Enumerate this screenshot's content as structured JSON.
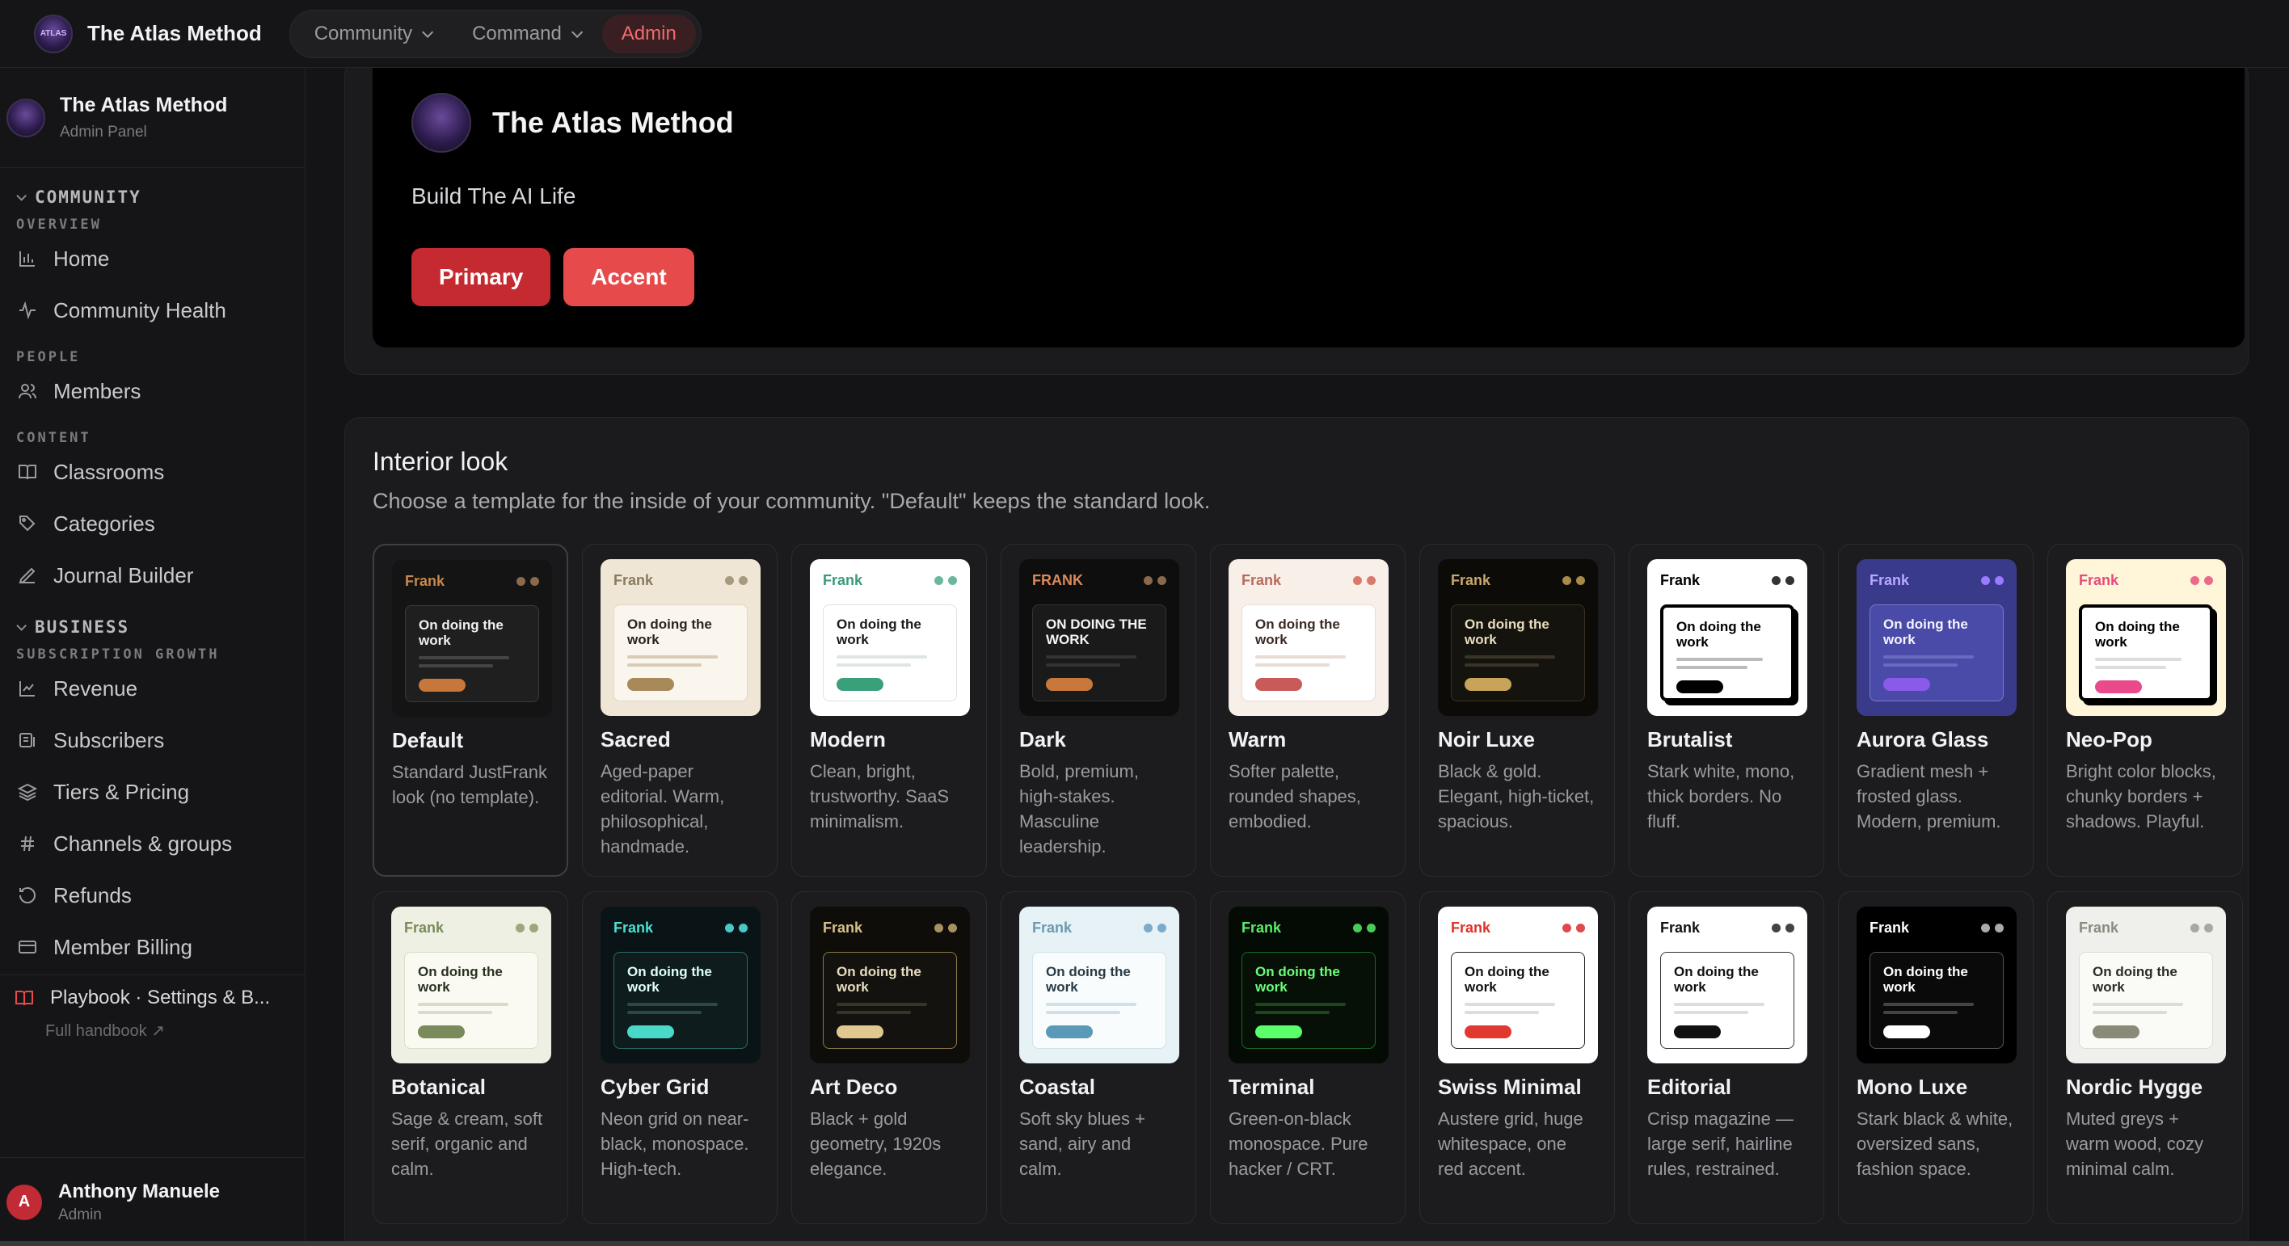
{
  "topbar": {
    "brand": "The Atlas Method",
    "logo_text": "ATLAS",
    "nav": [
      {
        "label": "Community",
        "chevron": true,
        "active": false
      },
      {
        "label": "Command",
        "chevron": true,
        "active": false
      },
      {
        "label": "Admin",
        "chevron": false,
        "active": true
      }
    ]
  },
  "sidebar": {
    "title": "The Atlas Method",
    "subtitle": "Admin Panel",
    "community_label": "COMMUNITY",
    "overview_label": "OVERVIEW",
    "home": "Home",
    "community_health": "Community Health",
    "people_label": "PEOPLE",
    "members": "Members",
    "content_label": "CONTENT",
    "classrooms": "Classrooms",
    "categories": "Categories",
    "journal_builder": "Journal Builder",
    "business_label": "BUSINESS",
    "subscription_label": "SUBSCRIPTION GROWTH",
    "revenue": "Revenue",
    "subscribers": "Subscribers",
    "tiers": "Tiers & Pricing",
    "channels": "Channels & groups",
    "refunds": "Refunds",
    "member_billing": "Member Billing",
    "playbook": "Playbook · Settings & B...",
    "full_handbook": "Full handbook ↗",
    "user_name": "Anthony Manuele",
    "user_role": "Admin",
    "user_initial": "A"
  },
  "preview": {
    "title": "The Atlas Method",
    "subtitle": "Build The AI Life",
    "primary": "Primary",
    "accent": "Accent"
  },
  "interior": {
    "title": "Interior look",
    "description": "Choose a template for the inside of your community. \"Default\" keeps the standard look.",
    "templates": [
      {
        "name": "Default",
        "desc": "Standard JustFrank look (no template).",
        "brand": "Frank",
        "heading": "On doing the work",
        "colors": {
          "bg": "#141414",
          "box": "#1f1f1f",
          "border": "#3a3a3a",
          "brand": "#c8894a",
          "text": "#f0f0f0",
          "line": "#444",
          "pill": "#c8773a",
          "dot": "#8a6a4a"
        }
      },
      {
        "name": "Sacred",
        "desc": "Aged-paper editorial. Warm, philosophical, handmade.",
        "brand": "Frank",
        "heading": "On doing the work",
        "colors": {
          "bg": "#efe6d6",
          "box": "#faf6ee",
          "border": "#e2d8c6",
          "brand": "#8a7a60",
          "text": "#2a2420",
          "line": "#d8ccb8",
          "pill": "#a88a5a",
          "dot": "#a89a80"
        }
      },
      {
        "name": "Modern",
        "desc": "Clean, bright, trustworthy. SaaS minimalism.",
        "brand": "Frank",
        "heading": "On doing the work",
        "colors": {
          "bg": "#ffffff",
          "box": "#ffffff",
          "border": "#dde3e0",
          "brand": "#3a9a7a",
          "text": "#1a1a1a",
          "line": "#dfe6e2",
          "pill": "#3aa07a",
          "dot": "#6ab89a"
        }
      },
      {
        "name": "Dark",
        "desc": "Bold, premium, high-stakes. Masculine leadership.",
        "brand": "FRANK",
        "heading": "ON DOING THE WORK",
        "colors": {
          "bg": "#0e0e0e",
          "box": "#1a1a1a",
          "border": "#333",
          "brand": "#d88a5a",
          "text": "#f4f4f4",
          "line": "#333",
          "pill": "#c8783a",
          "dot": "#8a6a4a"
        }
      },
      {
        "name": "Warm",
        "desc": "Softer palette, rounded shapes, embodied.",
        "brand": "Frank",
        "heading": "On doing the work",
        "colors": {
          "bg": "#f7efe8",
          "box": "#ffffff",
          "border": "#ecdcd2",
          "brand": "#b86a5a",
          "text": "#3a2a24",
          "line": "#e8dcd4",
          "pill": "#c85a5a",
          "dot": "#d87a6a"
        }
      },
      {
        "name": "Noir Luxe",
        "desc": "Black & gold. Elegant, high-ticket, spacious.",
        "brand": "Frank",
        "heading": "On doing the work",
        "colors": {
          "bg": "#0c0b08",
          "box": "#15130e",
          "border": "#3a3220",
          "brand": "#c8a86a",
          "text": "#e8dcc0",
          "line": "#3a3428",
          "pill": "#c8a45a",
          "dot": "#a88a4a"
        }
      },
      {
        "name": "Brutalist",
        "desc": "Stark white, mono, thick borders. No fluff.",
        "brand": "Frank",
        "heading": "On doing the work",
        "colors": {
          "bg": "#ffffff",
          "box": "#ffffff",
          "border": "#000000",
          "brand": "#000000",
          "text": "#000000",
          "line": "#bbbbbb",
          "pill": "#000000",
          "dot": "#333333"
        }
      },
      {
        "name": "Aurora Glass",
        "desc": "Gradient mesh + frosted glass. Modern, premium.",
        "brand": "Frank",
        "heading": "On doing the work",
        "colors": {
          "bg": "#3a3a8a",
          "box": "#4a4aa8",
          "border": "#7a7ac8",
          "brand": "#b8a8ff",
          "text": "#f4f4ff",
          "line": "#6a6ac0",
          "pill": "#8a5aea",
          "dot": "#9a7aff"
        }
      },
      {
        "name": "Neo-Pop",
        "desc": "Bright color blocks, chunky borders + shadows. Playful.",
        "brand": "Frank",
        "heading": "On doing the work",
        "colors": {
          "bg": "#fff6da",
          "box": "#ffffff",
          "border": "#000000",
          "brand": "#e84a7a",
          "text": "#000000",
          "line": "#dddddd",
          "pill": "#ea4a8a",
          "dot": "#ea6a8a"
        }
      },
      {
        "name": "Botanical",
        "desc": "Sage & cream, soft serif, organic and calm.",
        "brand": "Frank",
        "heading": "On doing the work",
        "colors": {
          "bg": "#eef0e4",
          "box": "#fafaf2",
          "border": "#d8dcc8",
          "brand": "#7a8a5a",
          "text": "#2a3020",
          "line": "#d8dcc8",
          "pill": "#7a8a5a",
          "dot": "#9aa87a"
        }
      },
      {
        "name": "Cyber Grid",
        "desc": "Neon grid on near-black, monospace. High-tech.",
        "brand": "Frank",
        "heading": "On doing the work",
        "colors": {
          "bg": "#0a1416",
          "box": "#0e1c1e",
          "border": "#2a6a6a",
          "brand": "#4ae0d0",
          "text": "#e0fffa",
          "line": "#2a4a4a",
          "pill": "#4ad8c8",
          "dot": "#4ac8c8"
        }
      },
      {
        "name": "Art Deco",
        "desc": "Black + gold geometry, 1920s elegance.",
        "brand": "Frank",
        "heading": "On doing the work",
        "colors": {
          "bg": "#0e0d0a",
          "box": "#14120e",
          "border": "#8a7a4a",
          "brand": "#d8c08a",
          "text": "#e8dcc0",
          "line": "#3a3428",
          "pill": "#e0c890",
          "dot": "#a89060"
        }
      },
      {
        "name": "Coastal",
        "desc": "Soft sky blues + sand, airy and calm.",
        "brand": "Frank",
        "heading": "On doing the work",
        "colors": {
          "bg": "#e6f2f6",
          "box": "#f8fcfd",
          "border": "#d0e2e8",
          "brand": "#6a9ab0",
          "text": "#2a3a44",
          "line": "#d0e0e6",
          "pill": "#5a9ab8",
          "dot": "#7aaacc"
        }
      },
      {
        "name": "Terminal",
        "desc": "Green-on-black monospace. Pure hacker / CRT.",
        "brand": "Frank",
        "heading": "On doing the work",
        "colors": {
          "bg": "#040a04",
          "box": "#061006",
          "border": "#1a6a2a",
          "brand": "#5aee6a",
          "text": "#6aff7a",
          "line": "#1a4a1a",
          "pill": "#5aff6a",
          "dot": "#4aca5a"
        }
      },
      {
        "name": "Swiss Minimal",
        "desc": "Austere grid, huge whitespace, one red accent.",
        "brand": "Frank",
        "heading": "On doing the work",
        "colors": {
          "bg": "#ffffff",
          "box": "#ffffff",
          "border": "#222222",
          "brand": "#e0302a",
          "text": "#111111",
          "line": "#dddddd",
          "pill": "#e03a30",
          "dot": "#e04a4a"
        }
      },
      {
        "name": "Editorial",
        "desc": "Crisp magazine — large serif, hairline rules, restrained.",
        "brand": "Frank",
        "heading": "On doing the work",
        "colors": {
          "bg": "#ffffff",
          "box": "#ffffff",
          "border": "#333333",
          "brand": "#111111",
          "text": "#111111",
          "line": "#dddddd",
          "pill": "#111111",
          "dot": "#444444"
        }
      },
      {
        "name": "Mono Luxe",
        "desc": "Stark black & white, oversized sans, fashion space.",
        "brand": "Frank",
        "heading": "On doing the work",
        "colors": {
          "bg": "#000000",
          "box": "#0a0a0a",
          "border": "#555555",
          "brand": "#ffffff",
          "text": "#ffffff",
          "line": "#444444",
          "pill": "#ffffff",
          "dot": "#aaaaaa"
        }
      },
      {
        "name": "Nordic Hygge",
        "desc": "Muted greys + warm wood, cozy minimal calm.",
        "brand": "Frank",
        "heading": "On doing the work",
        "colors": {
          "bg": "#efefeb",
          "box": "#fafaf7",
          "border": "#dcdcd6",
          "brand": "#8a8a80",
          "text": "#2a2a26",
          "line": "#dcdcd6",
          "pill": "#8a8a78",
          "dot": "#a8a8a0"
        }
      }
    ]
  }
}
